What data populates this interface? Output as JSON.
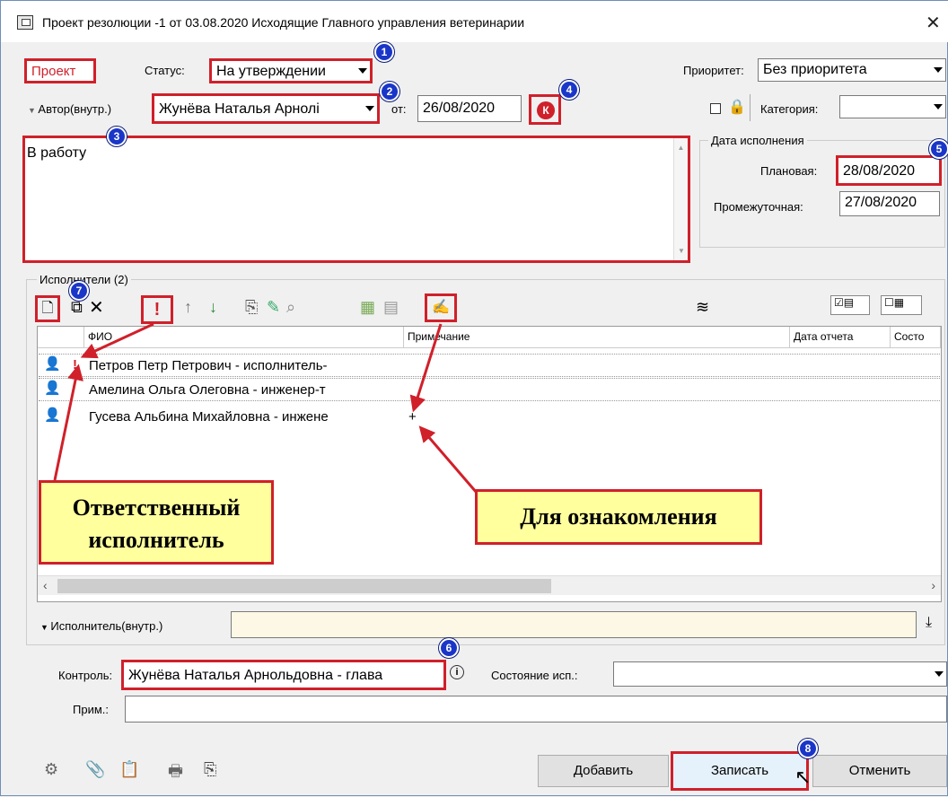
{
  "window": {
    "title": "Проект резолюции -1 от 03.08.2020 Исходящие Главного управления ветеринарии"
  },
  "header": {
    "project_tag": "Проект",
    "status_label": "Статус:",
    "status_value": "На утверждении",
    "priority_label": "Приоритет:",
    "priority_value": "Без приоритета",
    "author_label": "Автор(внутр.)",
    "author_value": "Жунёва Наталья Арнолі",
    "date_from_label": "от:",
    "date_from_value": "26/08/2020",
    "k_button": "К",
    "category_label": "Категория:",
    "category_value": ""
  },
  "resolution_text": "В работу",
  "due_dates": {
    "group_label": "Дата исполнения",
    "planned_label": "Плановая:",
    "planned_value": "28/08/2020",
    "interim_label": "Промежуточная:",
    "interim_value": "27/08/2020"
  },
  "executors": {
    "group_label": "Исполнители (2)",
    "columns": [
      "ФИО",
      "Примечание",
      "Дата отчета",
      "Состо"
    ],
    "rows": [
      {
        "mark": "!",
        "name": "Петров Петр Петрович - исполнитель-",
        "note": ""
      },
      {
        "mark": "",
        "name": "Амелина Ольга Олеговна - инженер-т",
        "note": ""
      },
      {
        "mark": "",
        "name": "Гусева Альбина Михайловна - инжене",
        "note": "+"
      }
    ],
    "executor_field_label": "Исполнитель(внутр.)",
    "executor_field_value": ""
  },
  "callouts": {
    "responsible": "Ответственный исполнитель",
    "for_review": "Для ознакомления"
  },
  "control": {
    "control_label": "Контроль:",
    "control_value": "Жунёва Наталья Арнольдовна - глава",
    "state_label": "Состояние исп.:",
    "state_value": "",
    "note_label": "Прим.:",
    "note_value": ""
  },
  "badges": [
    "1",
    "2",
    "3",
    "4",
    "5",
    "6",
    "7",
    "8"
  ],
  "buttons": {
    "add": "Добавить",
    "save": "Записать",
    "cancel": "Отменить"
  },
  "colors": {
    "highlight": "#d0202a",
    "badge": "#1a36c8",
    "callout_bg": "#ffff9e"
  }
}
